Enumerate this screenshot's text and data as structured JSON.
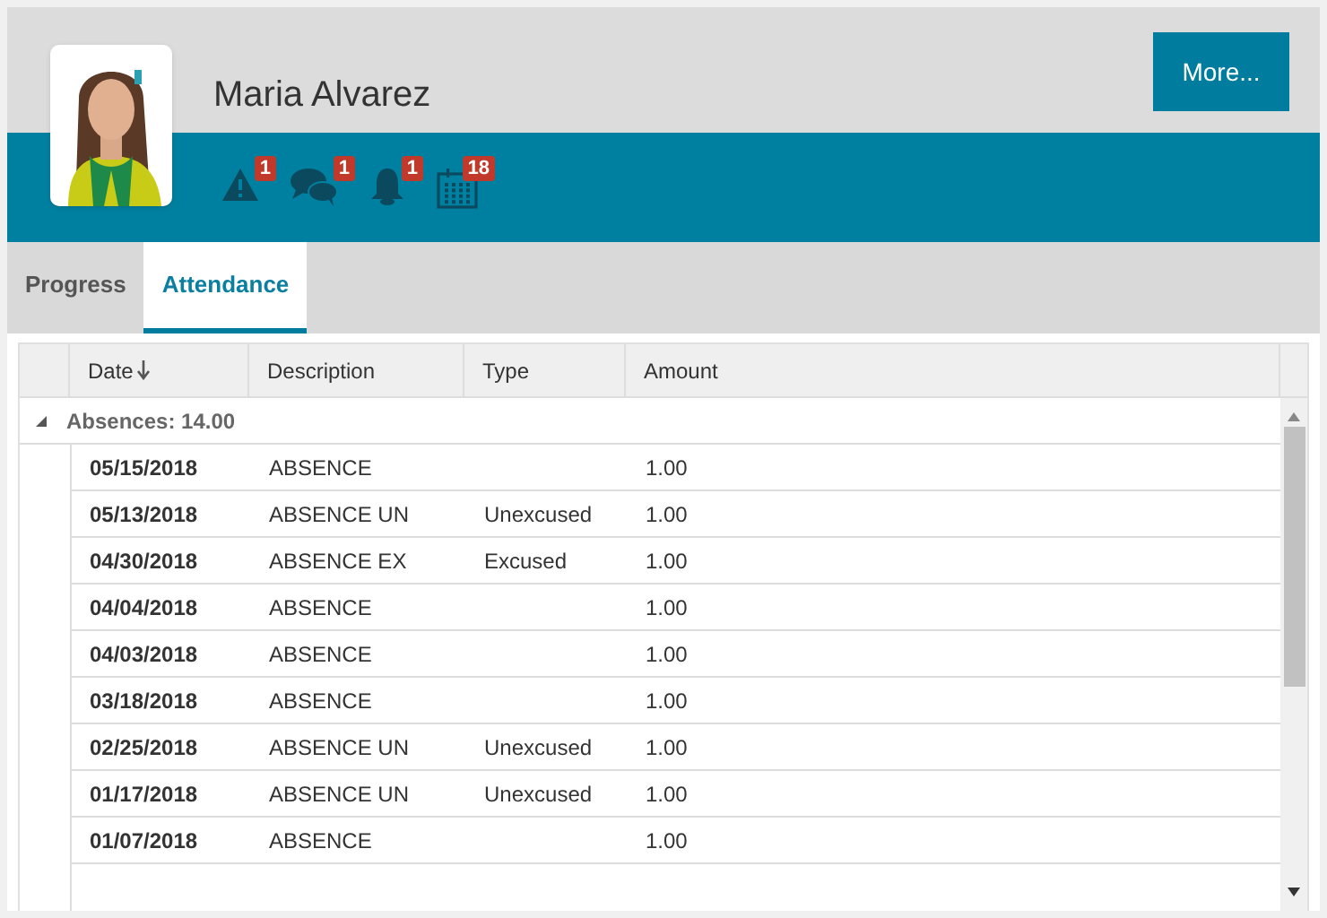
{
  "header": {
    "name": "Maria Alvarez",
    "more_button": "More...",
    "indicators": [
      {
        "kind": "alert",
        "count": "1"
      },
      {
        "kind": "messages",
        "count": "1"
      },
      {
        "kind": "bell",
        "count": "1"
      },
      {
        "kind": "calendar",
        "count": "18"
      }
    ]
  },
  "tabs": [
    {
      "label": "Progress",
      "selected": false
    },
    {
      "label": "Attendance",
      "selected": true
    }
  ],
  "table": {
    "columns": [
      {
        "label": "Date",
        "sorted_descending": true
      },
      {
        "label": "Description"
      },
      {
        "label": "Type"
      },
      {
        "label": "Amount"
      }
    ],
    "group": {
      "label": "Absences: 14.00",
      "expanded": true
    },
    "rows": [
      [
        "05/15/2018",
        "ABSENCE",
        "",
        "1.00"
      ],
      [
        "05/13/2018",
        "ABSENCE UN",
        "Unexcused",
        "1.00"
      ],
      [
        "04/30/2018",
        "ABSENCE EX",
        "Excused",
        "1.00"
      ],
      [
        "04/04/2018",
        "ABSENCE",
        "",
        "1.00"
      ],
      [
        "04/03/2018",
        "ABSENCE",
        "",
        "1.00"
      ],
      [
        "03/18/2018",
        "ABSENCE",
        "",
        "1.00"
      ],
      [
        "02/25/2018",
        "ABSENCE UN",
        "Unexcused",
        "1.00"
      ],
      [
        "01/17/2018",
        "ABSENCE UN",
        "Unexcused",
        "1.00"
      ],
      [
        "01/07/2018",
        "ABSENCE",
        "",
        "1.00"
      ]
    ]
  }
}
